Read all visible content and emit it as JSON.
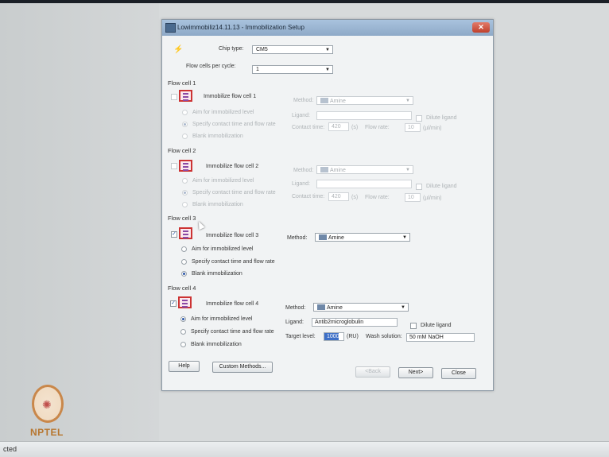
{
  "window": {
    "title": "Lowimmobiliz14.11.13 - Immobilization Setup",
    "close_glyph": "✕"
  },
  "chip": {
    "label": "Chip type:",
    "value": "CM5",
    "icon": "wizard-wand-icon"
  },
  "flow_cells_per_cycle": {
    "label": "Flow cells per cycle:",
    "value": "1"
  },
  "flow_cells": [
    {
      "section": "Flow cell 1",
      "immobilize_label": "Immobilize flow cell 1",
      "checked": false,
      "enabled": false,
      "method_label": "Method:",
      "method_value": "Amine",
      "options": [
        "Aim for immobilized level",
        "Specify contact time and flow rate",
        "Blank immobilization"
      ],
      "selected_option": 1,
      "ligand_label": "Ligand:",
      "ligand_value": "",
      "dilute_label": "Dilute ligand",
      "contact_label": "Contact time:",
      "contact_value": "420",
      "contact_unit": "(s)",
      "flow_label": "Flow rate:",
      "flow_value": "10",
      "flow_unit": "(µl/min)"
    },
    {
      "section": "Flow cell 2",
      "immobilize_label": "Immobilize flow cell 2",
      "checked": false,
      "enabled": false,
      "method_label": "Method:",
      "method_value": "Amine",
      "options": [
        "Aim for immobilized level",
        "Specify contact time and flow rate",
        "Blank immobilization"
      ],
      "selected_option": 1,
      "ligand_label": "Ligand:",
      "ligand_value": "",
      "dilute_label": "Dilute ligand",
      "contact_label": "Contact time:",
      "contact_value": "420",
      "contact_unit": "(s)",
      "flow_label": "Flow rate:",
      "flow_value": "10",
      "flow_unit": "(µl/min)"
    },
    {
      "section": "Flow cell 3",
      "immobilize_label": "Immobilize flow cell 3",
      "checked": true,
      "enabled": true,
      "method_label": "Method:",
      "method_value": "Amine",
      "options": [
        "Aim for immobilized level",
        "Specify contact time and flow rate",
        "Blank immobilization"
      ],
      "selected_option": 2
    },
    {
      "section": "Flow cell 4",
      "immobilize_label": "Immobilize flow cell 4",
      "checked": true,
      "enabled": true,
      "method_label": "Method:",
      "method_value": "Amine",
      "options": [
        "Aim for immobilized level",
        "Specify contact time and flow rate",
        "Blank immobilization"
      ],
      "selected_option": 0,
      "ligand_label": "Ligand:",
      "ligand_value": "Antib2microglobulin",
      "dilute_label": "Dilute ligand",
      "target_label": "Target level:",
      "target_value": "1000",
      "target_unit": "(RU)",
      "wash_label": "Wash solution:",
      "wash_value": "50 mM NaOH"
    }
  ],
  "buttons": {
    "help": "Help",
    "custom_methods": "Custom Methods...",
    "back": "<Back",
    "next": "Next>",
    "close": "Close"
  },
  "taskbar": {
    "text": "cted"
  },
  "watermark": {
    "text": "NPTEL"
  },
  "colors": {
    "title_bar": "#9bb5d3",
    "dialog_bg": "#f1f3f4",
    "accent": "#2a56a8",
    "flow_cell_icon_border": "#cc3333",
    "logo": "#b7762f"
  }
}
